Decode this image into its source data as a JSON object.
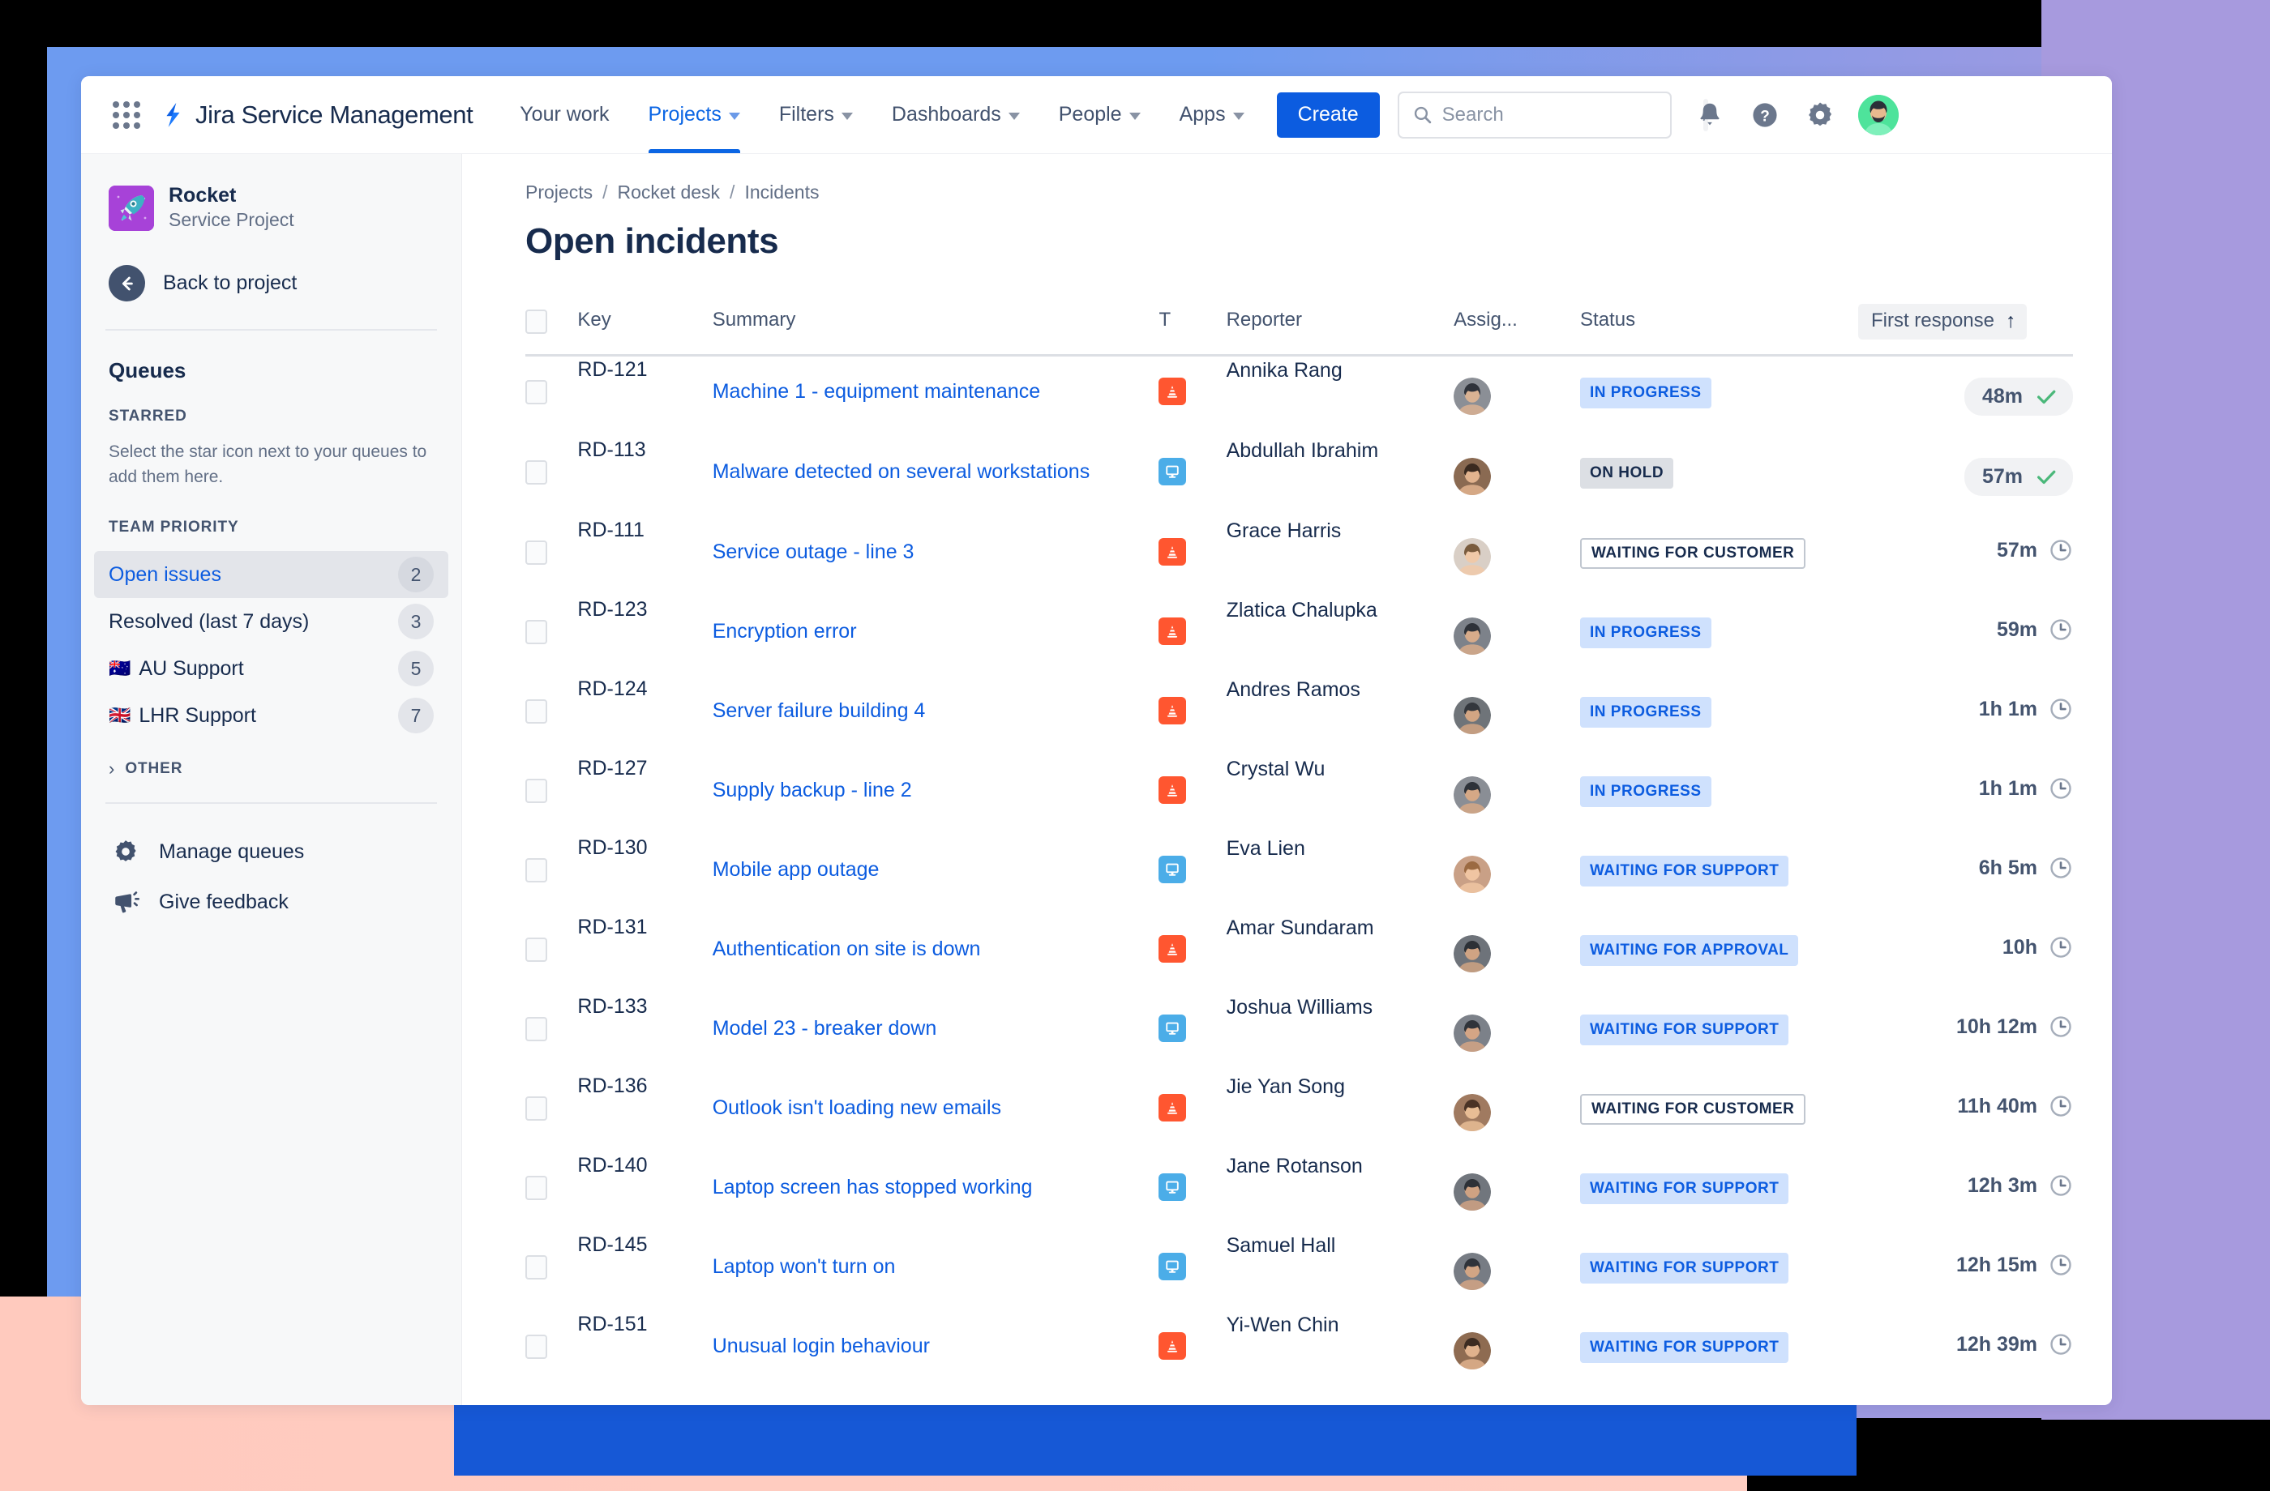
{
  "topnav": {
    "app_switcher": "app-switcher",
    "brand": "Jira Service Management",
    "items": [
      {
        "label": "Your work",
        "has_caret": false,
        "active": false
      },
      {
        "label": "Projects",
        "has_caret": true,
        "active": true
      },
      {
        "label": "Filters",
        "has_caret": true,
        "active": false
      },
      {
        "label": "Dashboards",
        "has_caret": true,
        "active": false
      },
      {
        "label": "People",
        "has_caret": true,
        "active": false
      },
      {
        "label": "Apps",
        "has_caret": true,
        "active": false
      }
    ],
    "create_label": "Create",
    "search": {
      "placeholder": "Search",
      "value": "",
      "shortcut": "/"
    },
    "icons": [
      "notifications-bell-icon",
      "help-question-icon",
      "settings-gear-icon",
      "user-avatar"
    ]
  },
  "sidebar": {
    "project": {
      "name": "Rocket",
      "type": "Service Project",
      "avatar_icon": "rocket-icon"
    },
    "back_label": "Back to project",
    "queues_title": "Queues",
    "starred_section": "STARRED",
    "starred_hint": "Select the star icon next to your queues to add them here.",
    "team_priority_section": "TEAM PRIORITY",
    "queues": [
      {
        "label": "Open issues",
        "count": "2",
        "flag": "",
        "active": true
      },
      {
        "label": "Resolved (last 7 days)",
        "count": "3",
        "flag": "",
        "active": false
      },
      {
        "label": "AU Support",
        "count": "5",
        "flag": "🇦🇺",
        "active": false
      },
      {
        "label": "LHR Support",
        "count": "7",
        "flag": "🇬🇧",
        "active": false
      }
    ],
    "other_section": "OTHER",
    "footer": [
      {
        "label": "Manage queues",
        "icon": "gear-icon"
      },
      {
        "label": "Give feedback",
        "icon": "megaphone-icon"
      }
    ]
  },
  "main": {
    "breadcrumb": [
      "Projects",
      "Rocket desk",
      "Incidents"
    ],
    "breadcrumb_separator": "/",
    "page_title": "Open incidents",
    "columns": {
      "checkbox": "",
      "key": "Key",
      "summary": "Summary",
      "type": "T",
      "reporter": "Reporter",
      "assignee": "Assig...",
      "status": "Status",
      "first_response": "First response",
      "sort_indicator": "↑"
    },
    "rows": [
      {
        "key": "RD-121",
        "summary": "Machine 1 - equipment maintenance",
        "type": "incident",
        "reporter": "Annika Rang",
        "status": "IN PROGRESS",
        "status_style": "blue",
        "first_response": "48m",
        "sla_state": "met"
      },
      {
        "key": "RD-113",
        "summary": "Malware detected on several workstations",
        "type": "service",
        "reporter": "Abdullah Ibrahim",
        "status": "ON HOLD",
        "status_style": "grey",
        "first_response": "57m",
        "sla_state": "met"
      },
      {
        "key": "RD-111",
        "summary": "Service outage - line 3",
        "type": "incident",
        "reporter": "Grace Harris",
        "status": "WAITING FOR CUSTOMER",
        "status_style": "hollow",
        "first_response": "57m",
        "sla_state": "pending"
      },
      {
        "key": "RD-123",
        "summary": "Encryption error",
        "type": "incident",
        "reporter": "Zlatica Chalupka",
        "status": "IN PROGRESS",
        "status_style": "blue",
        "first_response": "59m",
        "sla_state": "pending"
      },
      {
        "key": "RD-124",
        "summary": "Server failure building 4",
        "type": "incident",
        "reporter": "Andres Ramos",
        "status": "IN PROGRESS",
        "status_style": "blue",
        "first_response": "1h 1m",
        "sla_state": "pending"
      },
      {
        "key": "RD-127",
        "summary": "Supply backup - line 2",
        "type": "incident",
        "reporter": "Crystal Wu",
        "status": "IN PROGRESS",
        "status_style": "blue",
        "first_response": "1h 1m",
        "sla_state": "pending"
      },
      {
        "key": "RD-130",
        "summary": "Mobile app outage",
        "type": "service",
        "reporter": "Eva Lien",
        "status": "WAITING FOR SUPPORT",
        "status_style": "blue",
        "first_response": "6h 5m",
        "sla_state": "pending"
      },
      {
        "key": "RD-131",
        "summary": "Authentication on site is down",
        "type": "incident",
        "reporter": "Amar Sundaram",
        "status": "WAITING FOR APPROVAL",
        "status_style": "blue",
        "first_response": "10h",
        "sla_state": "pending"
      },
      {
        "key": "RD-133",
        "summary": "Model 23 - breaker down",
        "type": "service",
        "reporter": "Joshua Williams",
        "status": "WAITING FOR SUPPORT",
        "status_style": "blue",
        "first_response": "10h 12m",
        "sla_state": "pending"
      },
      {
        "key": "RD-136",
        "summary": "Outlook isn't loading new emails",
        "type": "incident",
        "reporter": "Jie Yan Song",
        "status": "WAITING FOR CUSTOMER",
        "status_style": "hollow",
        "first_response": "11h 40m",
        "sla_state": "pending"
      },
      {
        "key": "RD-140",
        "summary": "Laptop screen has stopped working",
        "type": "service",
        "reporter": "Jane Rotanson",
        "status": "WAITING FOR SUPPORT",
        "status_style": "blue",
        "first_response": "12h 3m",
        "sla_state": "pending"
      },
      {
        "key": "RD-145",
        "summary": "Laptop won't turn on",
        "type": "service",
        "reporter": "Samuel Hall",
        "status": "WAITING FOR SUPPORT",
        "status_style": "blue",
        "first_response": "12h 15m",
        "sla_state": "pending"
      },
      {
        "key": "RD-151",
        "summary": "Unusual login behaviour",
        "type": "incident",
        "reporter": "Yi-Wen Chin",
        "status": "WAITING FOR SUPPORT",
        "status_style": "blue",
        "first_response": "12h 39m",
        "sla_state": "pending"
      }
    ]
  },
  "colors": {
    "brand_blue": "#0c5ce0",
    "nav_active": "#0c66e4",
    "incident_orange": "#ff5630",
    "service_blue": "#4bade8",
    "status_blue_bg": "#cfe1fd",
    "status_grey_bg": "#dcdfe4",
    "sla_met_green": "#4bb87a",
    "text_primary": "#172b4d",
    "text_subtle": "#626f86"
  }
}
